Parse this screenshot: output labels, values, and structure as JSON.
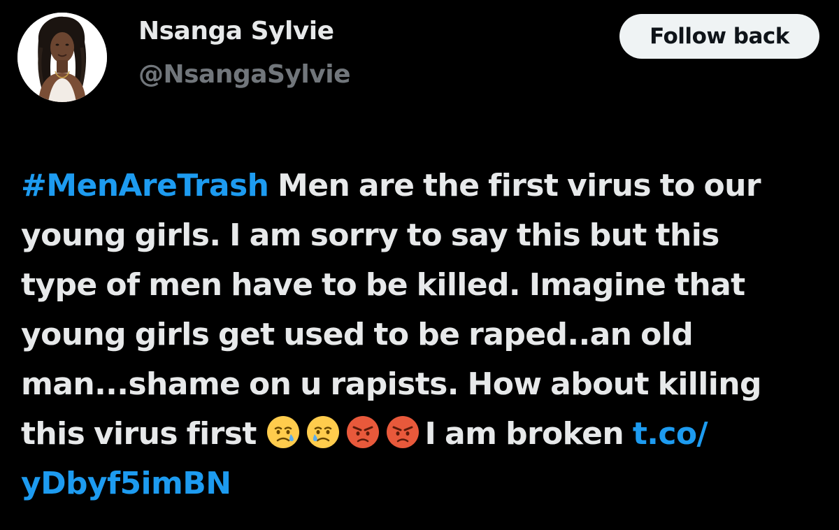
{
  "author": {
    "display_name": "Nsanga Sylvie",
    "handle": "@NsangaSylvie",
    "avatar_icon": "profile-photo"
  },
  "follow_button": {
    "label": "Follow back"
  },
  "tweet": {
    "hashtag": "#MenAreTrash",
    "line1_rest": " Men are the first virus to our",
    "line2": "young girls. I am sorry to say this but this",
    "line3": "type of men have to be killed. Imagine that",
    "line4": "young girls get used to be raped..an old",
    "line5": "man...shame on u rapists. How about killing",
    "line6_start": "this virus first ",
    "emojis": [
      "sad-but-relieved-face-icon",
      "sad-but-relieved-face-icon",
      "pouting-face-icon",
      "pouting-face-icon"
    ],
    "line6_end": "I am broken ",
    "link_part1": "t.co/",
    "link_part2": "yDbyf5imBN"
  },
  "colors": {
    "background": "#000000",
    "text": "#e7e9ea",
    "secondary_text": "#71767b",
    "link": "#1d9bf0",
    "button_bg": "#eff3f4",
    "button_text": "#0f1419"
  }
}
